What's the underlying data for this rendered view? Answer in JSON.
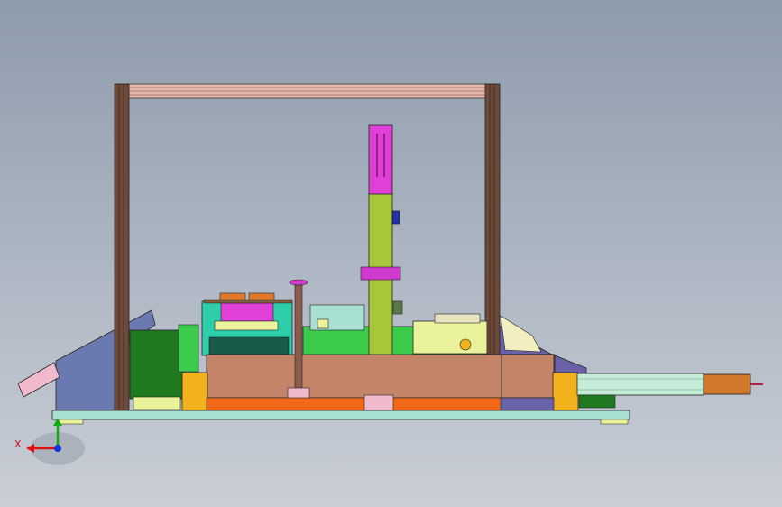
{
  "viewport": {
    "background_top": "#8e9bab",
    "background_bottom": "#c9ced6"
  },
  "triad": {
    "x_label": "X",
    "x_color": "#dd1111",
    "y_color": "#11aa11",
    "z_color": "#1133dd"
  },
  "parts": [
    {
      "name": "frame-post-left",
      "color": "#6e4a3a"
    },
    {
      "name": "frame-post-right",
      "color": "#6e4a3a"
    },
    {
      "name": "frame-top-beam",
      "color": "#e4b7ad"
    },
    {
      "name": "base-plate",
      "color": "#a8e0d2"
    },
    {
      "name": "main-body-block",
      "color": "#c48468"
    },
    {
      "name": "vertical-column",
      "color": "#a8c83c"
    },
    {
      "name": "column-top-block",
      "color": "#e040d8"
    },
    {
      "name": "green-housing",
      "color": "#3ccc4c"
    },
    {
      "name": "dark-green-block",
      "color": "#1f7a1f"
    },
    {
      "name": "left-ramp",
      "color": "#6a7ab0"
    },
    {
      "name": "left-ramp-plate",
      "color": "#f1b9cc"
    },
    {
      "name": "right-ramp",
      "color": "#6a62a8"
    },
    {
      "name": "slide-rail",
      "color": "#c4ecd6"
    },
    {
      "name": "slide-end-block",
      "color": "#d2782a"
    },
    {
      "name": "orange-bracket",
      "color": "#f2b21e"
    },
    {
      "name": "bottom-orange-strip",
      "color": "#f06818"
    },
    {
      "name": "yellow-cam-block",
      "color": "#eaf29c"
    },
    {
      "name": "magenta-clamp",
      "color": "#d03acf"
    },
    {
      "name": "blue-knob",
      "color": "#2233aa"
    }
  ]
}
